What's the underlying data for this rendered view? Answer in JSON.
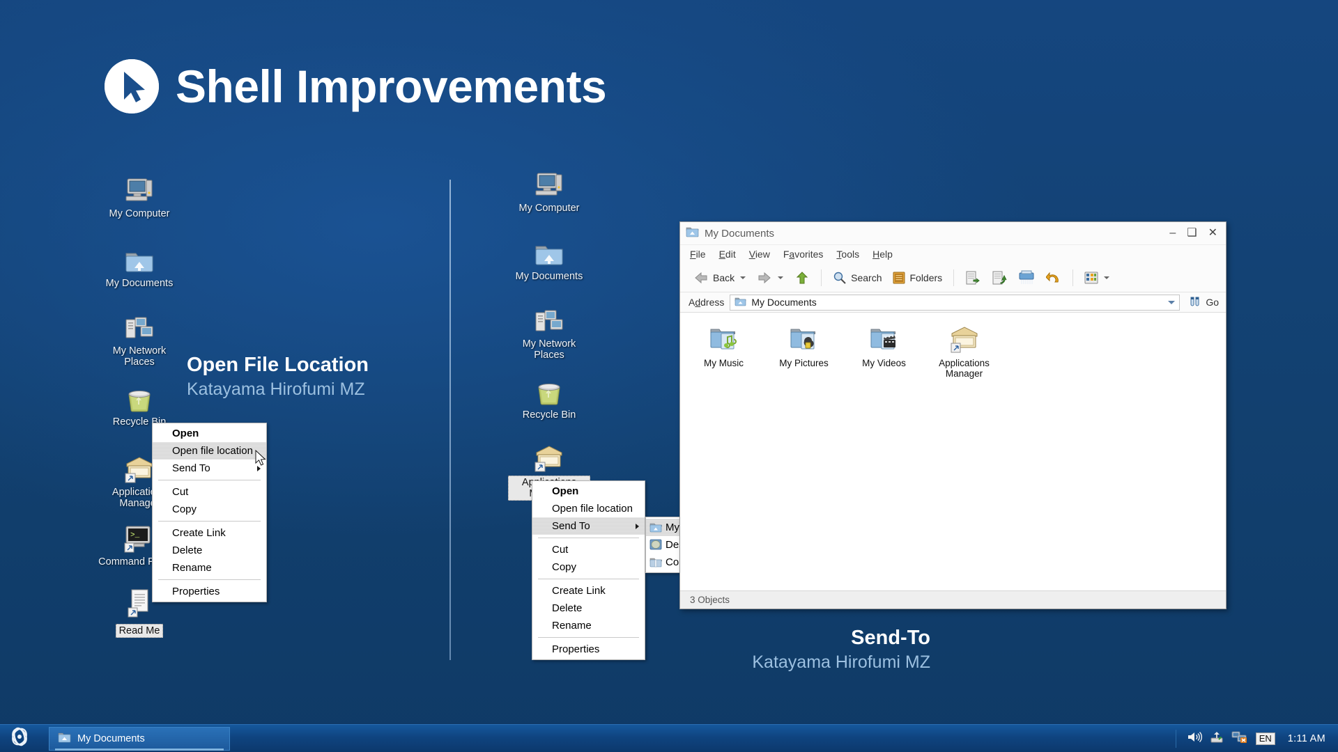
{
  "slide": {
    "title": "Shell Improvements",
    "title_icon": "cursor-badge-icon",
    "background_color": "#14457f"
  },
  "captions": [
    {
      "title": "Open File Location",
      "subtitle": "Katayama Hirofumi MZ"
    },
    {
      "title": "Send-To",
      "subtitle": "Katayama Hirofumi MZ"
    }
  ],
  "left_desktop": {
    "icons": [
      {
        "label": "My Computer",
        "icon": "my-computer-icon",
        "selected": false
      },
      {
        "label": "My Documents",
        "icon": "my-documents-folder-icon",
        "selected": false
      },
      {
        "label": "My Network Places",
        "icon": "my-network-places-icon",
        "selected": false
      },
      {
        "label": "Recycle Bin",
        "icon": "recycle-bin-icon",
        "selected": false
      },
      {
        "label": "Applications Manager",
        "icon": "applications-manager-icon",
        "selected": false
      },
      {
        "label": "Command Prompt",
        "icon": "command-prompt-icon",
        "selected": false
      },
      {
        "label": "Read Me",
        "icon": "text-document-icon",
        "selected": true
      }
    ]
  },
  "right_desktop": {
    "icons": [
      {
        "label": "My Computer",
        "icon": "my-computer-icon",
        "selected": false
      },
      {
        "label": "My Documents",
        "icon": "my-documents-folder-icon",
        "selected": false
      },
      {
        "label": "My Network Places",
        "icon": "my-network-places-icon",
        "selected": false
      },
      {
        "label": "Recycle Bin",
        "icon": "recycle-bin-icon",
        "selected": false
      },
      {
        "label": "Applications Manager",
        "icon": "applications-manager-icon",
        "selected": true
      }
    ]
  },
  "context_menu_left": {
    "items": [
      {
        "label": "Open",
        "bold": true,
        "highlighted": false,
        "submenu": false
      },
      {
        "label": "Open file location",
        "bold": false,
        "highlighted": true,
        "submenu": false
      },
      {
        "label": "Send To",
        "bold": false,
        "highlighted": false,
        "submenu": true
      },
      {
        "separator": true
      },
      {
        "label": "Cut",
        "bold": false,
        "highlighted": false,
        "submenu": false
      },
      {
        "label": "Copy",
        "bold": false,
        "highlighted": false,
        "submenu": false
      },
      {
        "separator": true
      },
      {
        "label": "Create Link",
        "bold": false,
        "highlighted": false,
        "submenu": false
      },
      {
        "label": "Delete",
        "bold": false,
        "highlighted": false,
        "submenu": false
      },
      {
        "label": "Rename",
        "bold": false,
        "highlighted": false,
        "submenu": false
      },
      {
        "separator": true
      },
      {
        "label": "Properties",
        "bold": false,
        "highlighted": false,
        "submenu": false
      }
    ]
  },
  "context_menu_right": {
    "items": [
      {
        "label": "Open",
        "bold": true,
        "highlighted": false,
        "submenu": false
      },
      {
        "label": "Open file location",
        "bold": false,
        "highlighted": false,
        "submenu": false
      },
      {
        "label": "Send To",
        "bold": false,
        "highlighted": true,
        "submenu": true
      },
      {
        "separator": true
      },
      {
        "label": "Cut",
        "bold": false,
        "highlighted": false,
        "submenu": false
      },
      {
        "label": "Copy",
        "bold": false,
        "highlighted": false,
        "submenu": false
      },
      {
        "separator": true
      },
      {
        "label": "Create Link",
        "bold": false,
        "highlighted": false,
        "submenu": false
      },
      {
        "label": "Delete",
        "bold": false,
        "highlighted": false,
        "submenu": false
      },
      {
        "label": "Rename",
        "bold": false,
        "highlighted": false,
        "submenu": false
      },
      {
        "separator": true
      },
      {
        "label": "Properties",
        "bold": false,
        "highlighted": false,
        "submenu": false
      }
    ],
    "submenu": {
      "items": [
        {
          "label": "My Documents",
          "icon": "my-documents-folder-icon",
          "highlighted": true
        },
        {
          "label": "Desktop (Create shortcut)",
          "icon": "desktop-icon",
          "highlighted": false
        },
        {
          "label": "Compressed (zipped) Folder",
          "icon": "zipped-folder-icon",
          "highlighted": false
        }
      ]
    }
  },
  "explorer_window": {
    "title": "My Documents",
    "title_icon": "my-documents-folder-icon",
    "controls": {
      "minimize": "–",
      "maximize": "❑",
      "close": "✕"
    },
    "menubar": [
      "File",
      "Edit",
      "View",
      "Favorites",
      "Tools",
      "Help"
    ],
    "toolbar": {
      "back_label": "Back",
      "search_label": "Search",
      "folders_label": "Folders",
      "buttons": [
        "back-button",
        "forward-button",
        "up-button",
        "search-button",
        "folders-button",
        "move-to-button",
        "copy-to-button",
        "delete-button",
        "undo-button",
        "views-button"
      ]
    },
    "address": {
      "label": "Address",
      "value": "My Documents",
      "go_label": "Go"
    },
    "files": [
      {
        "label": "My Music",
        "icon": "my-music-folder-icon"
      },
      {
        "label": "My Pictures",
        "icon": "my-pictures-folder-icon"
      },
      {
        "label": "My Videos",
        "icon": "my-videos-folder-icon"
      },
      {
        "label": "Applications Manager",
        "icon": "applications-manager-icon"
      }
    ],
    "status": "3 Objects"
  },
  "taskbar": {
    "start_icon": "reactos-start-icon",
    "tasks": [
      {
        "label": "My Documents",
        "icon": "my-documents-folder-icon",
        "active": true
      }
    ],
    "tray": {
      "icons": [
        "volume-icon",
        "safely-remove-hardware-icon",
        "network-disconnected-icon"
      ],
      "language": "EN",
      "clock": "1:11 AM"
    }
  }
}
